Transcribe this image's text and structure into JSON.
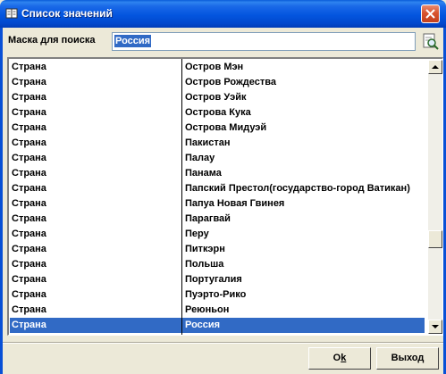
{
  "window": {
    "title": "Список значений",
    "icon": "book-icon",
    "close_icon": "close-icon"
  },
  "search": {
    "label": "Маска для поиска",
    "value": "Россия",
    "button_icon": "search-icon"
  },
  "list": {
    "rows": [
      {
        "type": "Страна",
        "value": "Остров Мэн"
      },
      {
        "type": "Страна",
        "value": "Остров Рождества"
      },
      {
        "type": "Страна",
        "value": "Остров Уэйк"
      },
      {
        "type": "Страна",
        "value": "Острова Кука"
      },
      {
        "type": "Страна",
        "value": "Острова Мидуэй"
      },
      {
        "type": "Страна",
        "value": "Пакистан"
      },
      {
        "type": "Страна",
        "value": "Палау"
      },
      {
        "type": "Страна",
        "value": "Панама"
      },
      {
        "type": "Страна",
        "value": "Папский Престол(государство-город Ватикан)"
      },
      {
        "type": "Страна",
        "value": "Папуа Новая Гвинея"
      },
      {
        "type": "Страна",
        "value": "Парагвай"
      },
      {
        "type": "Страна",
        "value": "Перу"
      },
      {
        "type": "Страна",
        "value": "Питкэрн"
      },
      {
        "type": "Страна",
        "value": "Польша"
      },
      {
        "type": "Страна",
        "value": "Португалия"
      },
      {
        "type": "Страна",
        "value": "Пуэрто-Рико"
      },
      {
        "type": "Страна",
        "value": "Реюньон"
      },
      {
        "type": "Страна",
        "value": "Россия"
      }
    ],
    "selected_index": 17
  },
  "buttons": {
    "ok": "Ok",
    "exit": "Выход"
  },
  "colors": {
    "titlebar": "#0355df",
    "selection": "#316ac5",
    "window_bg": "#ece9d8"
  }
}
